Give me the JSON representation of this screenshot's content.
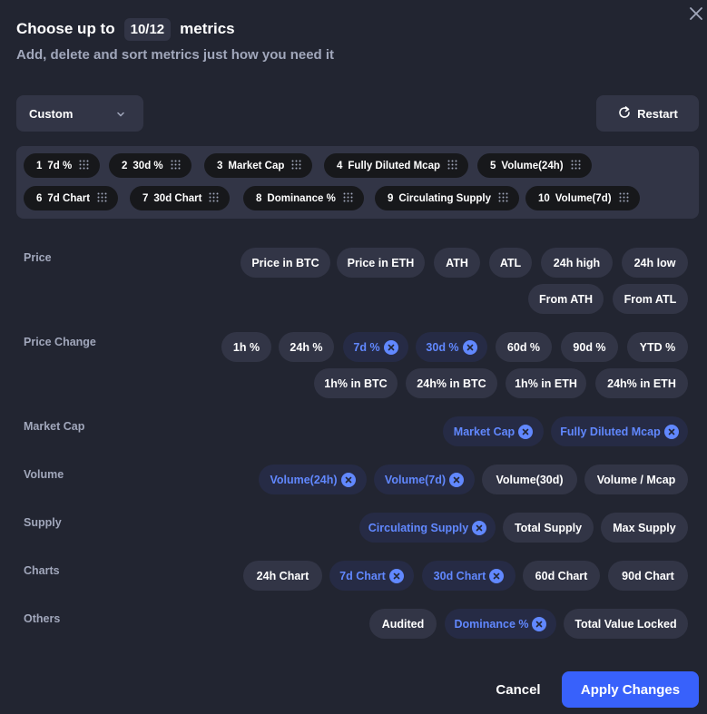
{
  "header": {
    "title_prefix": "Choose up to",
    "count": "10/12",
    "title_suffix": "metrics",
    "subtitle": "Add, delete and sort metrics just how you need it"
  },
  "preset": {
    "value": "Custom"
  },
  "restart_label": "Restart",
  "selected_metrics": [
    {
      "num": "1",
      "label": "7d %"
    },
    {
      "num": "2",
      "label": "30d %"
    },
    {
      "num": "3",
      "label": "Market Cap"
    },
    {
      "num": "4",
      "label": "Fully Diluted Mcap"
    },
    {
      "num": "5",
      "label": "Volume(24h)"
    },
    {
      "num": "6",
      "label": "7d Chart"
    },
    {
      "num": "7",
      "label": "30d Chart"
    },
    {
      "num": "8",
      "label": "Dominance %"
    },
    {
      "num": "9",
      "label": "Circulating Supply"
    },
    {
      "num": "10",
      "label": "Volume(7d)"
    }
  ],
  "categories": [
    {
      "name": "Price",
      "options": [
        {
          "label": "Price in BTC",
          "selected": false
        },
        {
          "label": "Price in ETH",
          "selected": false
        },
        {
          "label": "ATH",
          "selected": false
        },
        {
          "label": "ATL",
          "selected": false
        },
        {
          "label": "24h high",
          "selected": false
        },
        {
          "label": "24h low",
          "selected": false
        },
        {
          "label": "From ATH",
          "selected": false
        },
        {
          "label": "From ATL",
          "selected": false
        }
      ]
    },
    {
      "name": "Price Change",
      "options": [
        {
          "label": "1h %",
          "selected": false
        },
        {
          "label": "24h %",
          "selected": false
        },
        {
          "label": "7d %",
          "selected": true
        },
        {
          "label": "30d %",
          "selected": true
        },
        {
          "label": "60d %",
          "selected": false
        },
        {
          "label": "90d %",
          "selected": false
        },
        {
          "label": "YTD %",
          "selected": false
        },
        {
          "label": "1h% in BTC",
          "selected": false
        },
        {
          "label": "24h% in BTC",
          "selected": false
        },
        {
          "label": "1h% in ETH",
          "selected": false
        },
        {
          "label": "24h% in ETH",
          "selected": false
        }
      ]
    },
    {
      "name": "Market Cap",
      "options": [
        {
          "label": "Market Cap",
          "selected": true
        },
        {
          "label": "Fully Diluted Mcap",
          "selected": true
        }
      ]
    },
    {
      "name": "Volume",
      "options": [
        {
          "label": "Volume(24h)",
          "selected": true
        },
        {
          "label": "Volume(7d)",
          "selected": true
        },
        {
          "label": "Volume(30d)",
          "selected": false
        },
        {
          "label": "Volume / Mcap",
          "selected": false
        }
      ]
    },
    {
      "name": "Supply",
      "options": [
        {
          "label": "Circulating Supply",
          "selected": true
        },
        {
          "label": "Total Supply",
          "selected": false
        },
        {
          "label": "Max Supply",
          "selected": false
        }
      ]
    },
    {
      "name": "Charts",
      "options": [
        {
          "label": "24h Chart",
          "selected": false
        },
        {
          "label": "7d Chart",
          "selected": true
        },
        {
          "label": "30d Chart",
          "selected": true
        },
        {
          "label": "60d Chart",
          "selected": false
        },
        {
          "label": "90d Chart",
          "selected": false
        }
      ]
    },
    {
      "name": "Others",
      "options": [
        {
          "label": "Audited",
          "selected": false
        },
        {
          "label": "Dominance %",
          "selected": true
        },
        {
          "label": "Total Value Locked",
          "selected": false
        }
      ]
    }
  ],
  "footer": {
    "cancel_label": "Cancel",
    "apply_label": "Apply Changes"
  },
  "colors": {
    "background": "#222531",
    "chip": "#323546",
    "accent": "#3861fb",
    "selected_text": "#6188ff"
  }
}
